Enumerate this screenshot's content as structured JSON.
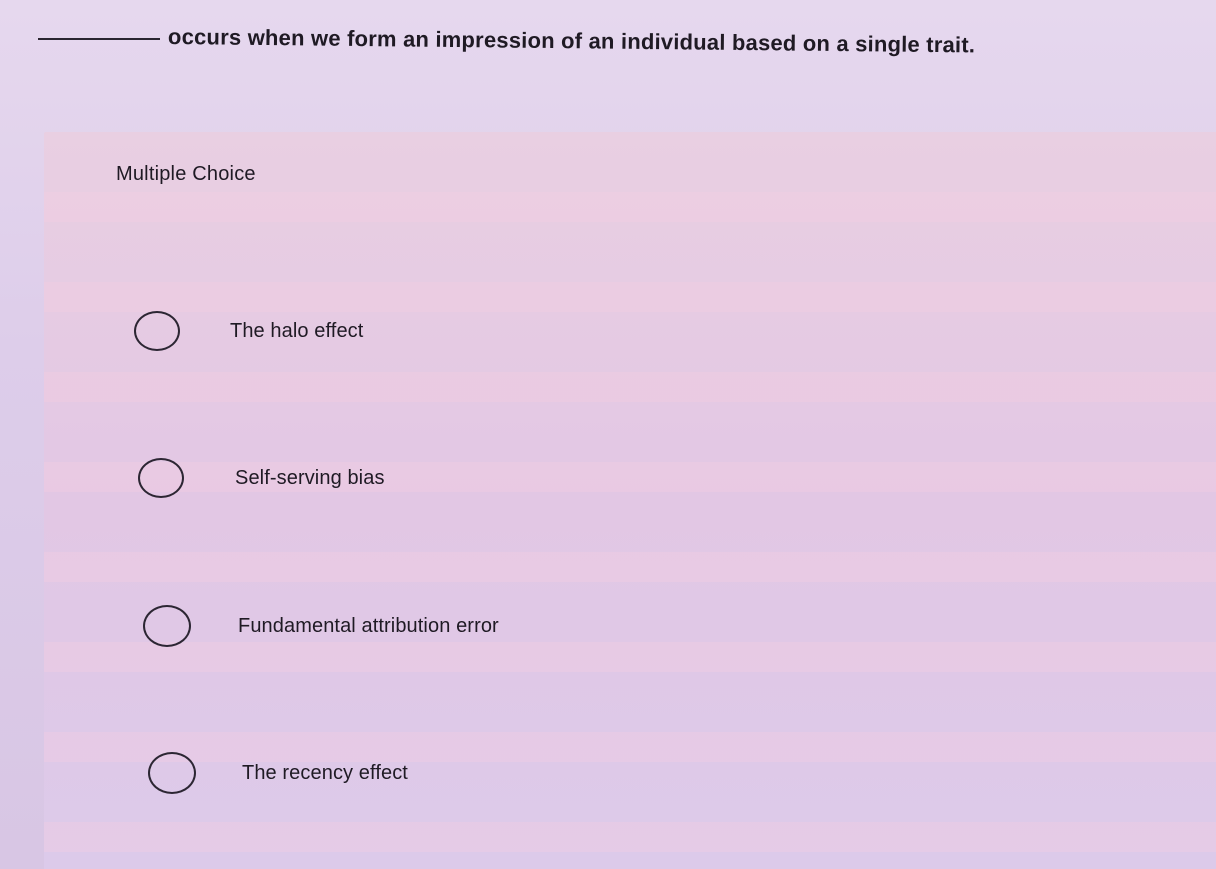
{
  "question": {
    "text": "occurs when we form an impression of an individual based on a single trait."
  },
  "section": {
    "label": "Multiple Choice"
  },
  "options": [
    {
      "label": "The halo effect"
    },
    {
      "label": "Self-serving bias"
    },
    {
      "label": "Fundamental attribution error"
    },
    {
      "label": "The recency effect"
    }
  ]
}
